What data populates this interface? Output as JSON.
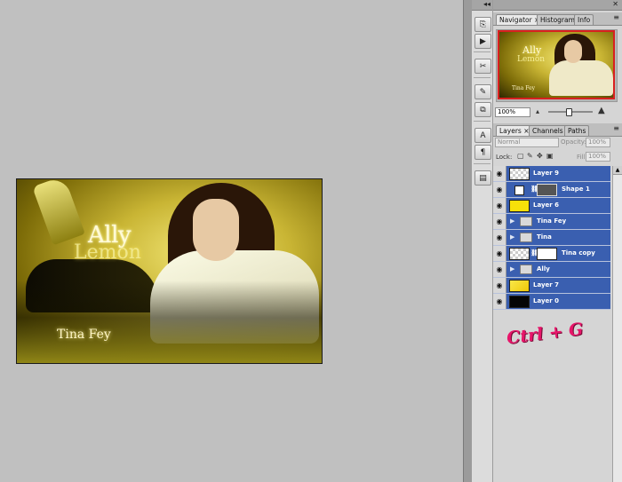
{
  "canvas": {
    "title_line1": "Ally",
    "title_line2": "Lemon",
    "caption": "Tina Fey"
  },
  "dock": {
    "collapse_glyph": "◂◂",
    "close_glyph": "✕"
  },
  "navigator_group": {
    "tabs": [
      {
        "label": "Navigator",
        "active": true,
        "close": "×"
      },
      {
        "label": "Histogram",
        "active": false
      },
      {
        "label": "Info",
        "active": false
      }
    ],
    "menu_glyph": "≡",
    "zoom_value": "100%",
    "zoom_out_icon": "mountain-small",
    "zoom_in_icon": "mountain-large",
    "zoom_slider_fraction": 0.45
  },
  "layers_group": {
    "tabs": [
      {
        "label": "Layers",
        "active": true,
        "close": "×"
      },
      {
        "label": "Channels",
        "active": false
      },
      {
        "label": "Paths",
        "active": false
      }
    ],
    "menu_glyph": "≡",
    "blend_mode": "Normal",
    "opacity_label": "Opacity:",
    "opacity_value": "100%",
    "lock_label": "Lock:",
    "fill_label": "Fill:",
    "fill_value": "100%",
    "layers": [
      {
        "name": "Layer 9",
        "thumb": "checker",
        "kind": "layer"
      },
      {
        "name": "Shape 1",
        "thumb": "white",
        "kind": "shape"
      },
      {
        "name": "Layer 6",
        "thumb": "yellow",
        "kind": "layer"
      },
      {
        "name": "Tina Fey",
        "kind": "group"
      },
      {
        "name": "Tina",
        "kind": "group"
      },
      {
        "name": "Tina copy",
        "thumb": "checker",
        "kind": "masked"
      },
      {
        "name": "Ally",
        "kind": "group"
      },
      {
        "name": "Layer 7",
        "thumb": "yellowtex",
        "kind": "layer"
      },
      {
        "name": "Layer 0",
        "thumb": "black",
        "kind": "layer"
      }
    ]
  },
  "annotation": "Ctrl + G",
  "colors": {
    "workspace": "#c0c0c0",
    "layer_selected": "#3a5fb0",
    "annotation": "#e8156a",
    "navigator_frame": "#d82020"
  }
}
